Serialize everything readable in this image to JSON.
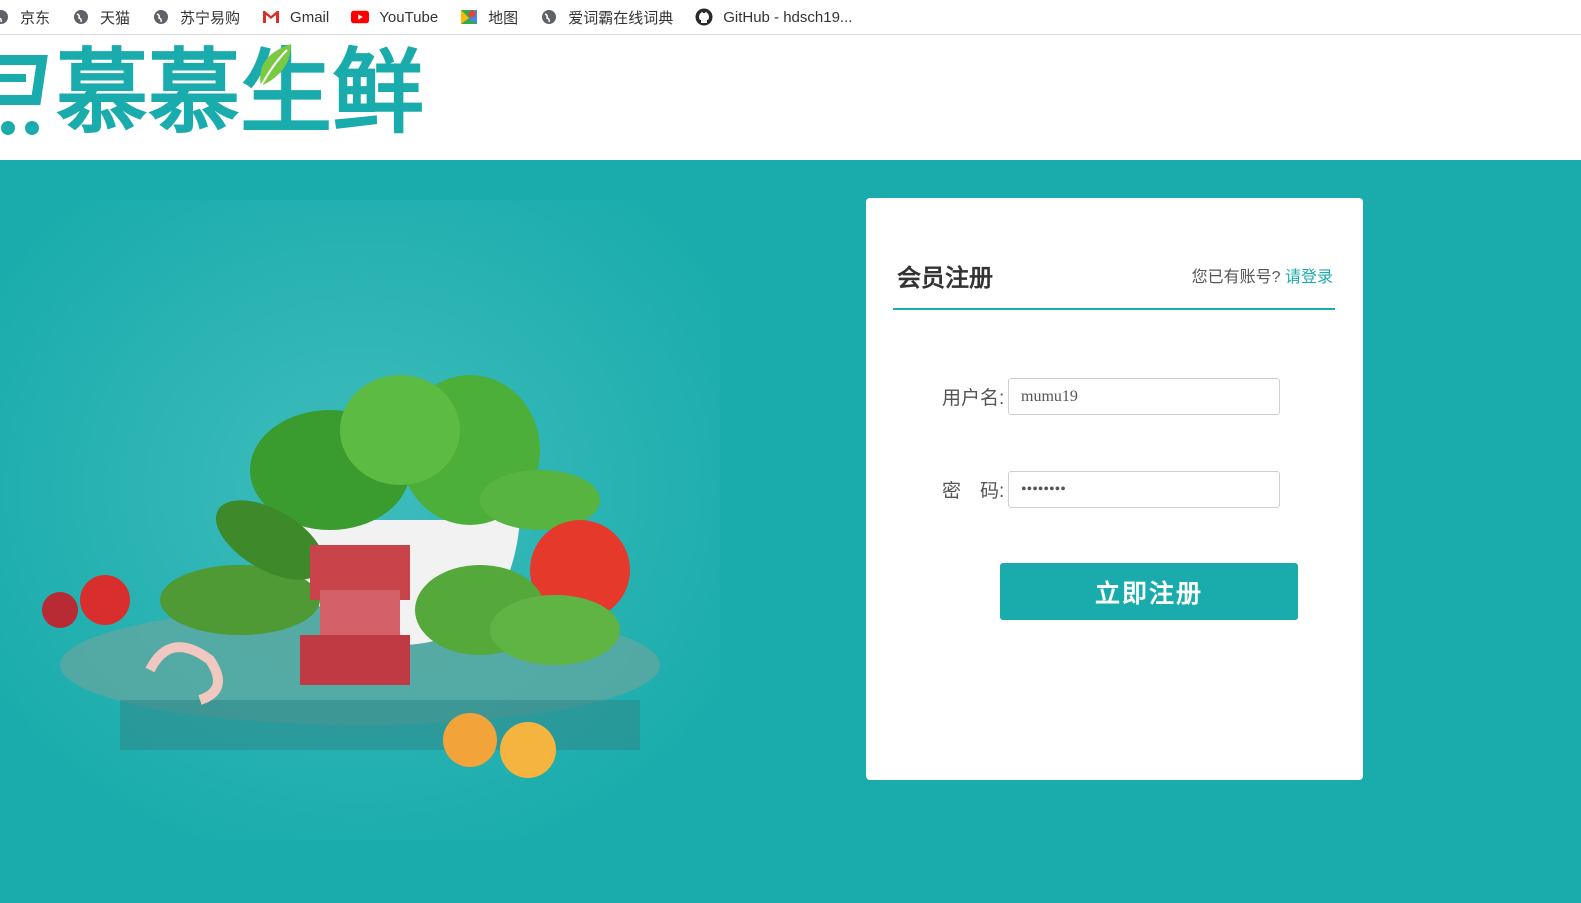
{
  "bookmarks": [
    {
      "label": "京东",
      "icon": "globe-icon"
    },
    {
      "label": "天猫",
      "icon": "globe-icon"
    },
    {
      "label": "苏宁易购",
      "icon": "globe-icon"
    },
    {
      "label": "Gmail",
      "icon": "gmail-icon"
    },
    {
      "label": "YouTube",
      "icon": "youtube-icon"
    },
    {
      "label": "地图",
      "icon": "maps-icon"
    },
    {
      "label": "爱词霸在线词典",
      "icon": "globe-icon"
    },
    {
      "label": "GitHub - hdsch19...",
      "icon": "github-icon"
    }
  ],
  "header": {
    "logo_text": "慕慕生鲜",
    "logo_icon": "cart-icon"
  },
  "register": {
    "title": "会员注册",
    "have_account": "您已有账号?",
    "login_link": "请登录",
    "username_label": "用户名:",
    "username_value": "mumu19",
    "password_label": "密　码:",
    "password_value": "••••••••",
    "submit_label": "立即注册"
  },
  "colors": {
    "brand": "#1aacac",
    "text": "#333333"
  }
}
